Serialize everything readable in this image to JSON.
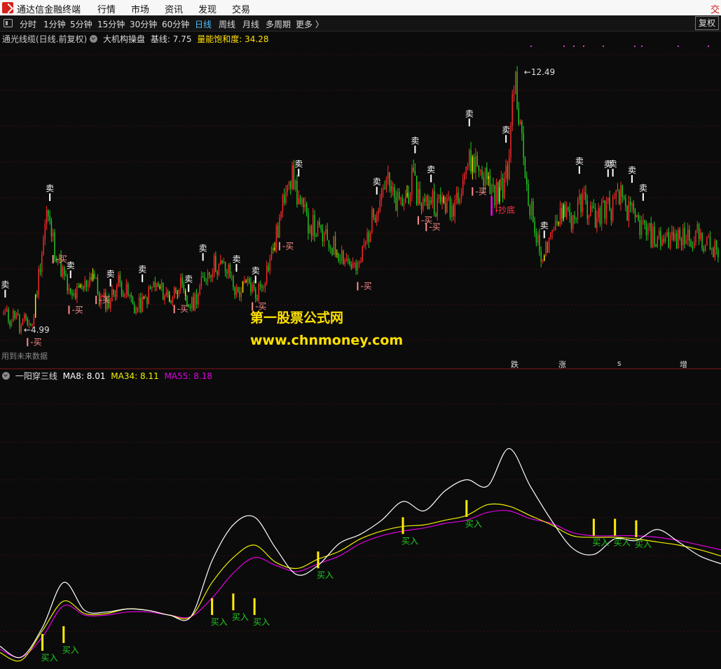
{
  "menubar": {
    "app_title": "通达信金融终端",
    "items": [
      "行情",
      "市场",
      "资讯",
      "发现",
      "交易"
    ],
    "right_label": "交"
  },
  "toolbar": {
    "periods": [
      "分时",
      "1分钟",
      "5分钟",
      "15分钟",
      "30分钟",
      "60分钟",
      "日线",
      "周线",
      "月线",
      "多周期",
      "更多 〉"
    ],
    "active_period": "日线",
    "fuquan": "复权"
  },
  "main_panel": {
    "title": "通光线缆(日线.前复权)",
    "indicator_name": "大机构操盘",
    "base_label": "基线:",
    "base_value": "7.75",
    "energy_label": "量能饱和度:",
    "energy_value": "34.28",
    "high_price": "12.49",
    "low_price": "4.99",
    "future_note": "用到未来数据",
    "watermark_cn": "第一股票公式网",
    "watermark_url": "www.chnmoney.com",
    "signal_sell": "卖",
    "signal_buy": "买",
    "signal_bottom": "抄底",
    "status_tags": [
      {
        "text": "跌",
        "color": "#2ecc2e"
      },
      {
        "text": "涨",
        "color": "#ff3030"
      },
      {
        "text": "s",
        "color": "#ff3030"
      },
      {
        "text": "增",
        "color": "#ffdd00"
      }
    ]
  },
  "sub_panel": {
    "title": "一阳穿三线",
    "ma8_label": "MA8:",
    "ma8_value": "8.01",
    "ma34_label": "MA34:",
    "ma34_value": "8.11",
    "ma55_label": "MA55:",
    "ma55_value": "8.18",
    "buy_label": "买入"
  },
  "colors": {
    "up": "#ff2a2a",
    "down": "#22cc22",
    "yellow": "#ffee00",
    "ma8": "#ffffff",
    "ma34": "#f0f000",
    "ma55": "#e000e0",
    "buy": "#ff8c8c",
    "sell": "#ffffff",
    "bottom": "#ff3344"
  },
  "chart_data": [
    {
      "type": "candlestick",
      "title": "通光线缆(日线.前复权)",
      "ylim": [
        4.3,
        13.2
      ],
      "highest": 12.49,
      "lowest": 4.99,
      "anchors_close": [
        [
          0,
          5.5
        ],
        [
          4,
          5.3
        ],
        [
          8,
          5.55
        ],
        [
          10,
          5.0
        ],
        [
          14,
          5.3
        ],
        [
          18,
          5.1
        ],
        [
          22,
          6.6
        ],
        [
          27,
          8.4
        ],
        [
          32,
          7.4
        ],
        [
          36,
          6.8
        ],
        [
          42,
          5.9
        ],
        [
          50,
          6.2
        ],
        [
          56,
          6.7
        ],
        [
          60,
          5.9
        ],
        [
          66,
          5.8
        ],
        [
          72,
          6.4
        ],
        [
          78,
          6.0
        ],
        [
          83,
          5.6
        ],
        [
          88,
          5.8
        ],
        [
          94,
          6.3
        ],
        [
          100,
          6.1
        ],
        [
          105,
          5.9
        ],
        [
          110,
          6.4
        ],
        [
          114,
          5.8
        ],
        [
          118,
          5.7
        ],
        [
          121,
          6.0
        ],
        [
          127,
          6.6
        ],
        [
          132,
          6.9
        ],
        [
          138,
          6.8
        ],
        [
          142,
          6.6
        ],
        [
          146,
          6.05
        ],
        [
          150,
          6.2
        ],
        [
          154,
          6.35
        ],
        [
          158,
          6.0
        ],
        [
          163,
          6.45
        ],
        [
          168,
          7.2
        ],
        [
          172,
          7.9
        ],
        [
          175,
          8.6
        ],
        [
          178,
          9.6
        ],
        [
          182,
          9.3
        ],
        [
          186,
          8.6
        ],
        [
          190,
          8.2
        ],
        [
          196,
          7.9
        ],
        [
          202,
          7.6
        ],
        [
          210,
          7.3
        ],
        [
          218,
          6.9
        ],
        [
          222,
          6.7
        ],
        [
          226,
          7.4
        ],
        [
          230,
          8.0
        ],
        [
          236,
          9.0
        ],
        [
          240,
          9.4
        ],
        [
          244,
          8.8
        ],
        [
          248,
          8.6
        ],
        [
          252,
          8.8
        ],
        [
          256,
          9.3
        ],
        [
          260,
          8.9
        ],
        [
          264,
          8.6
        ],
        [
          268,
          8.9
        ],
        [
          272,
          8.6
        ],
        [
          276,
          8.8
        ],
        [
          280,
          8.4
        ],
        [
          286,
          9.2
        ],
        [
          290,
          9.8
        ],
        [
          295,
          9.9
        ],
        [
          300,
          9.6
        ],
        [
          305,
          9.2
        ],
        [
          310,
          8.9
        ],
        [
          316,
          9.5
        ],
        [
          320,
          12.4
        ],
        [
          324,
          10.8
        ],
        [
          328,
          9.2
        ],
        [
          332,
          8.2
        ],
        [
          336,
          7.2
        ],
        [
          340,
          7.3
        ],
        [
          344,
          7.6
        ],
        [
          348,
          8.4
        ],
        [
          352,
          8.6
        ],
        [
          356,
          8.2
        ],
        [
          360,
          8.5
        ],
        [
          364,
          8.75
        ],
        [
          368,
          8.4
        ],
        [
          372,
          8.2
        ],
        [
          376,
          8.6
        ],
        [
          380,
          8.5
        ],
        [
          384,
          8.7
        ],
        [
          388,
          8.9
        ],
        [
          392,
          8.4
        ],
        [
          396,
          8.2
        ],
        [
          400,
          8.0
        ],
        [
          404,
          7.8
        ],
        [
          410,
          7.6
        ],
        [
          416,
          7.7
        ],
        [
          422,
          7.6
        ],
        [
          428,
          7.7
        ],
        [
          436,
          7.75
        ],
        [
          440,
          7.5
        ],
        [
          448,
          7.2
        ]
      ],
      "sell_days": [
        1,
        29,
        42,
        67,
        87,
        116,
        125,
        146,
        158,
        185,
        234,
        258,
        268,
        292,
        315,
        339,
        361,
        379,
        382,
        394,
        401
      ],
      "buy_days": [
        15,
        31,
        41,
        58,
        107,
        156,
        173,
        222,
        260,
        265,
        294
      ],
      "bottom_day": 306
    },
    {
      "type": "line",
      "title": "一阳穿三线",
      "series": [
        {
          "name": "MA8",
          "values": [
            7.95,
            7.6,
            8.55,
            10.0,
            9.1,
            9.05,
            9.15,
            9.1,
            8.95,
            8.9,
            10.7,
            11.85,
            12.1,
            11.1,
            10.25,
            10.55,
            11.25,
            11.55,
            12.0,
            12.6,
            12.3,
            12.95,
            13.3,
            13.1,
            14.3,
            13.1,
            12.0,
            11.1,
            10.9,
            11.4,
            11.35,
            11.7,
            11.3,
            10.85,
            10.6
          ],
          "color": "#ffffff"
        },
        {
          "name": "MA34",
          "values": [
            7.75,
            7.5,
            8.45,
            9.4,
            9.0,
            9.0,
            9.15,
            9.1,
            8.95,
            8.9,
            10.0,
            10.8,
            11.2,
            10.65,
            10.45,
            10.75,
            11.0,
            11.4,
            11.65,
            11.8,
            11.85,
            12.0,
            12.15,
            12.5,
            12.45,
            12.15,
            11.85,
            11.5,
            11.45,
            11.45,
            11.4,
            11.3,
            11.2,
            11.05,
            10.85
          ],
          "color": "#f0f000"
        },
        {
          "name": "MA55",
          "values": [
            7.85,
            7.6,
            8.25,
            9.25,
            8.95,
            8.95,
            9.05,
            9.05,
            8.95,
            8.9,
            9.5,
            10.3,
            10.8,
            10.55,
            10.35,
            10.6,
            10.85,
            11.25,
            11.5,
            11.65,
            11.75,
            11.9,
            12.0,
            12.25,
            12.3,
            12.05,
            11.9,
            11.6,
            11.5,
            11.5,
            11.5,
            11.45,
            11.35,
            11.2,
            11.05
          ],
          "color": "#e000e0"
        }
      ],
      "buy_signals": [
        {
          "idx": 2,
          "y": 7.85
        },
        {
          "idx": 3,
          "y": 8.1
        },
        {
          "idx": 10,
          "y": 9.0
        },
        {
          "idx": 11,
          "y": 9.15
        },
        {
          "idx": 12,
          "y": 9.0
        },
        {
          "idx": 15,
          "y": 10.5
        },
        {
          "idx": 19,
          "y": 11.6
        },
        {
          "idx": 22,
          "y": 12.15
        },
        {
          "idx": 28,
          "y": 11.55
        },
        {
          "idx": 29,
          "y": 11.55
        },
        {
          "idx": 30,
          "y": 11.5
        }
      ]
    }
  ]
}
